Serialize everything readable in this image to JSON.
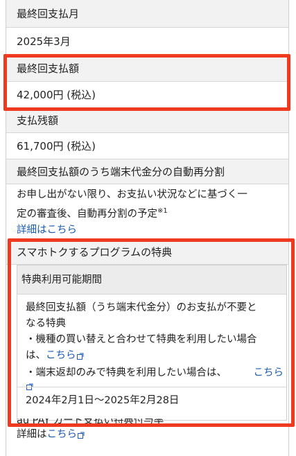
{
  "rows": {
    "final_month_label": "最終回支払月",
    "final_month_value": "2025年3月",
    "final_amount_label": "最終回支払額",
    "final_amount_value": "42,000円 (税込)",
    "remaining_label": "支払残額",
    "remaining_value": "61,700円 (税込)",
    "redivision_label": "最終回支払額のうち端末代金分の自動再分割"
  },
  "redivision_note": {
    "text_line1": "お申し出がない限り、お支払い状況などに基づく一",
    "text_line2": "定の審査後、自動再分割の予定",
    "footnote": "※1",
    "details_link": "詳細はこちら"
  },
  "smatoku": {
    "title": "スマホトクするプログラムの特典",
    "period_header": "特典利用可能期間",
    "desc_line1": "最終回支払額（うち端末代金分）のお支払が不要と",
    "desc_line2": "なる特典",
    "bullet1_line1": "・機種の買い替えと合わせて特典を利用したい場合",
    "bullet1_line2": "は、",
    "bullet1_link": "こちら",
    "bullet2_text": "・端末返却のみで特典を利用したい場合は、",
    "bullet2_link": "こちら",
    "period": "2024年2月1日〜2025年2月28日"
  },
  "bottom": {
    "partial_text": "au PAY カード支払い特典付与率",
    "details_link": "詳細はこちら"
  },
  "colors": {
    "highlight": "#f03a20",
    "link": "#1a5bb3",
    "header_bg": "#f2f2f2"
  },
  "icons": [
    "external-link-icon"
  ]
}
